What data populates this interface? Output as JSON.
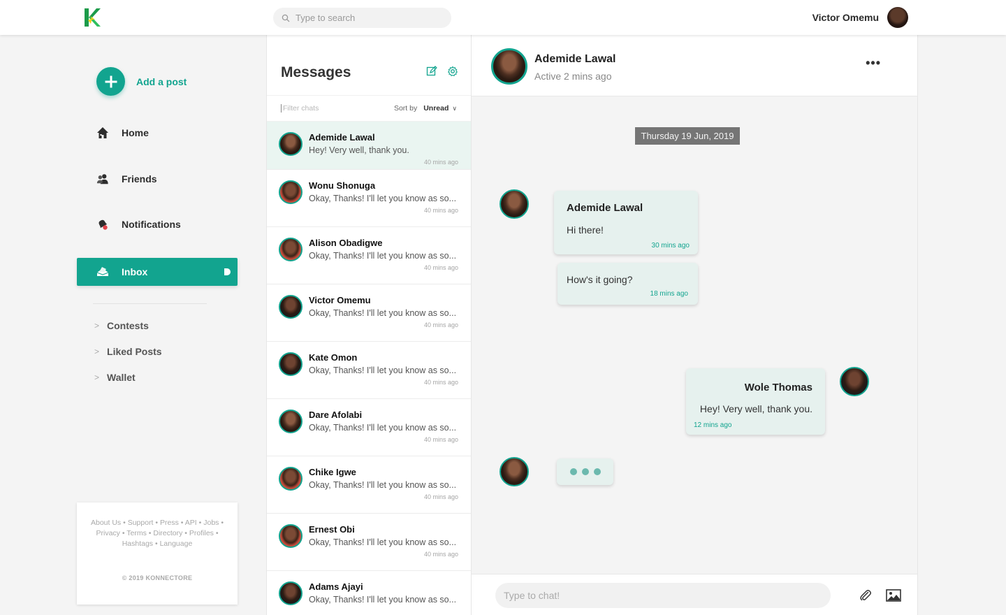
{
  "header": {
    "logo_letter": "K",
    "search_placeholder": "Type to search",
    "user_name": "Victor Omemu"
  },
  "sidebar": {
    "add_post_label": "Add a post",
    "nav": [
      {
        "label": "Home",
        "icon": "home-icon"
      },
      {
        "label": "Friends",
        "icon": "friends-icon"
      },
      {
        "label": "Notifications",
        "icon": "bell-icon"
      },
      {
        "label": "Inbox",
        "icon": "inbox-icon",
        "active": true
      }
    ],
    "sub_items": [
      "Contests",
      "Liked Posts",
      "Wallet"
    ],
    "footer": {
      "links": [
        "About Us",
        "Support",
        "Press",
        "API",
        "Jobs",
        "Privacy",
        "Terms",
        "Directory",
        "Profiles",
        "Hashtags",
        "Language"
      ],
      "copyright": "© 2019 KONNECTORE"
    }
  },
  "messages": {
    "title": "Messages",
    "filter_placeholder": "Filter chats",
    "sort_label": "Sort by",
    "sort_value": "Unread",
    "chats": [
      {
        "name": "Ademide Lawal",
        "preview": "Hey! Very well, thank you.",
        "time": "40 mins ago",
        "selected": true
      },
      {
        "name": "Wonu Shonuga",
        "preview": "Okay, Thanks! I'll let you know as so...",
        "time": "40 mins ago"
      },
      {
        "name": "Alison Obadigwe",
        "preview": "Okay, Thanks! I'll let you know as so...",
        "time": "40 mins ago"
      },
      {
        "name": "Victor Omemu",
        "preview": "Okay, Thanks! I'll let you know as so...",
        "time": "40 mins ago"
      },
      {
        "name": "Kate Omon",
        "preview": "Okay, Thanks! I'll let you know as so...",
        "time": "40 mins ago"
      },
      {
        "name": "Dare Afolabi",
        "preview": "Okay, Thanks! I'll let you know as so...",
        "time": "40 mins ago"
      },
      {
        "name": "Chike Igwe",
        "preview": "Okay, Thanks! I'll let you know as so...",
        "time": "40 mins ago"
      },
      {
        "name": "Ernest Obi",
        "preview": "Okay, Thanks! I'll let you know as so...",
        "time": "40 mins ago"
      },
      {
        "name": "Adams Ajayi",
        "preview": "Okay, Thanks! I'll let you know as so...",
        "time": ""
      }
    ]
  },
  "conversation": {
    "contact_name": "Ademide Lawal",
    "contact_status": "Active 2 mins ago",
    "more_label": "•••",
    "date_label": "Thursday 19 Jun, 2019",
    "messages": [
      {
        "sender": "Ademide Lawal",
        "text": "Hi there!",
        "time": "30 mins ago"
      },
      {
        "sender": "",
        "text": "How's it going?",
        "time": "18 mins ago"
      },
      {
        "sender": "Wole Thomas",
        "text": "Hey! Very well, thank you.",
        "time": "12 mins ago"
      }
    ],
    "composer_placeholder": "Type to chat!"
  },
  "colors": {
    "accent": "#12a48f",
    "bubble": "#e6f1ee",
    "selected_chat": "#eaf5f1",
    "date_pill": "#757575"
  }
}
